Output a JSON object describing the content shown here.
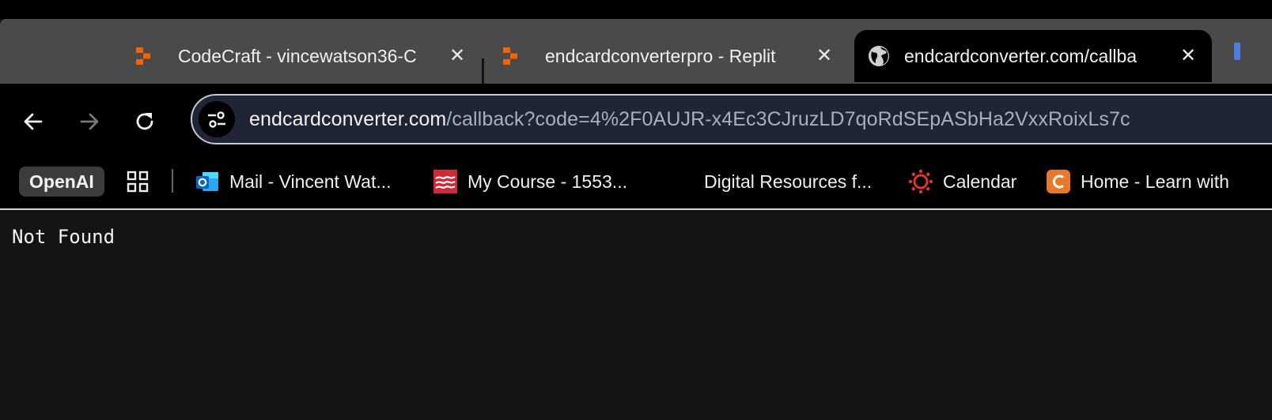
{
  "tabs": [
    {
      "title": "CodeCraft - vincewatson36-C",
      "icon": "replit-icon",
      "close": "✕"
    },
    {
      "title": "endcardconverterpro - Replit",
      "icon": "replit-icon",
      "close": "✕"
    },
    {
      "title": "endcardconverter.com/callba",
      "icon": "globe-icon",
      "close": "✕",
      "active": true
    }
  ],
  "address": {
    "host": "endcardconverter.com",
    "path": "/callback?code=4%2F0AUJR-x4Ec3CJruzLD7qoRdSEpASbHa2VxxRoixLs7c"
  },
  "bookmarks": {
    "openai": "OpenAI",
    "items": [
      {
        "label": "Mail - Vincent Wat...",
        "icon": "outlook-icon"
      },
      {
        "label": "My Course - 1553...",
        "icon": "pearson-icon"
      },
      {
        "label": "Digital Resources f...",
        "icon": "none"
      },
      {
        "label": "Calendar",
        "icon": "canvas-icon"
      },
      {
        "label": "Home - Learn with",
        "icon": "c-icon"
      }
    ]
  },
  "page": {
    "message": "Not Found"
  },
  "colors": {
    "accent_orange": "#f26207",
    "outlook_blue": "#0a64c8",
    "canvas_red": "#e1342a",
    "pearson_red": "#cf2a36",
    "c_orange": "#e8782a"
  }
}
